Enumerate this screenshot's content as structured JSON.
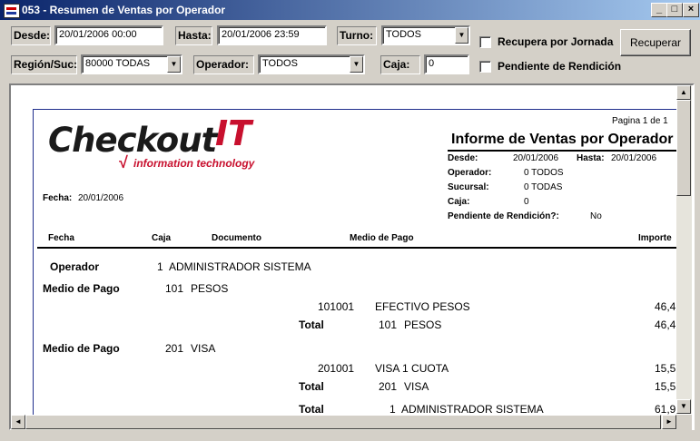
{
  "window": {
    "title": "053 - Resumen de Ventas por Operador",
    "controls": [
      "_",
      "□",
      "×"
    ]
  },
  "filters": {
    "desde": {
      "label": "Desde:",
      "value": "20/01/2006 00:00"
    },
    "hasta": {
      "label": "Hasta:",
      "value": "20/01/2006 23:59"
    },
    "turno": {
      "label": "Turno:",
      "value": "TODOS"
    },
    "region": {
      "label": "Región/Suc:",
      "value": "80000 TODAS"
    },
    "operador": {
      "label": "Operador:",
      "value": "TODOS"
    },
    "caja": {
      "label": "Caja:",
      "value": "0"
    },
    "recupera_jornada": {
      "label": "Recupera por Jornada",
      "checked": false
    },
    "pendiente_rendicion": {
      "label": "Pendiente de Rendición",
      "checked": false
    },
    "recuperar_button": "Recuperar"
  },
  "report": {
    "logo": {
      "brand": "Checkout",
      "it": "IT",
      "tagline": "information technology"
    },
    "pagination": "Pagina 1 de 1",
    "title": "Informe de Ventas por Operador",
    "fecha": {
      "label": "Fecha:",
      "value": "20/01/2006"
    },
    "params": {
      "desde_label": "Desde:",
      "desde_value": "20/01/2006",
      "hasta_label": "Hasta:",
      "hasta_value": "20/01/2006",
      "operador_label": "Operador:",
      "operador_value": "0 TODOS",
      "sucursal_label": "Sucursal:",
      "sucursal_value": "0 TODAS",
      "caja_label": "Caja:",
      "caja_value": "0",
      "pendiente_label": "Pendiente de Rendición?:",
      "pendiente_value": "No"
    },
    "columns": {
      "fecha": "Fecha",
      "caja": "Caja",
      "documento": "Documento",
      "medio": "Medio de Pago",
      "importe": "Importe"
    },
    "operador": {
      "label": "Operador",
      "code": "1",
      "name": "ADMINISTRADOR SISTEMA"
    },
    "medio1": {
      "label": "Medio de Pago",
      "code": "101",
      "name": "PESOS",
      "detail_code": "101001",
      "detail_name": "EFECTIVO PESOS",
      "detail_amount": "46,4",
      "total_label": "Total",
      "total_code": "101",
      "total_name": "PESOS",
      "total_amount": "46,4"
    },
    "medio2": {
      "label": "Medio de Pago",
      "code": "201",
      "name": "VISA",
      "detail_code": "201001",
      "detail_name": "VISA 1 CUOTA",
      "detail_amount": "15,5",
      "total_label": "Total",
      "total_code": "201",
      "total_name": "VISA",
      "total_amount": "15,5"
    },
    "grand_total": {
      "label": "Total",
      "code": "1",
      "name": "ADMINISTRADOR SISTEMA",
      "amount": "61,9"
    }
  }
}
